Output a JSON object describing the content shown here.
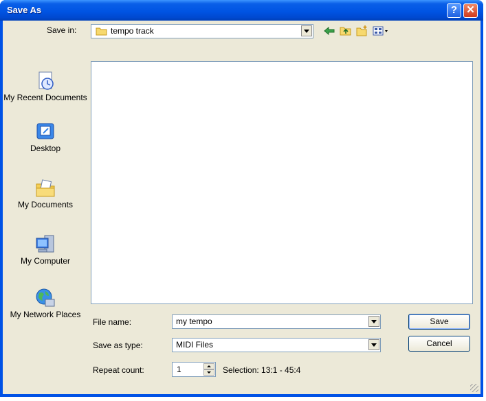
{
  "window": {
    "title": "Save As"
  },
  "titlebar": {
    "help": "?",
    "close": "✕"
  },
  "save_in": {
    "label": "Save in:",
    "value": "tempo track"
  },
  "places": [
    {
      "label": "My Recent Documents",
      "icon": "recent-documents-icon"
    },
    {
      "label": "Desktop",
      "icon": "desktop-icon"
    },
    {
      "label": "My Documents",
      "icon": "my-documents-icon"
    },
    {
      "label": "My Computer",
      "icon": "my-computer-icon"
    },
    {
      "label": "My Network Places",
      "icon": "network-places-icon"
    }
  ],
  "file_name": {
    "label": "File name:",
    "value": "my tempo"
  },
  "save_as_type": {
    "label": "Save as type:",
    "value": "MIDI Files"
  },
  "repeat_count": {
    "label": "Repeat count:",
    "value": "1"
  },
  "selection": {
    "text": "Selection: 13:1 - 45:4"
  },
  "buttons": {
    "save": "Save",
    "cancel": "Cancel"
  }
}
